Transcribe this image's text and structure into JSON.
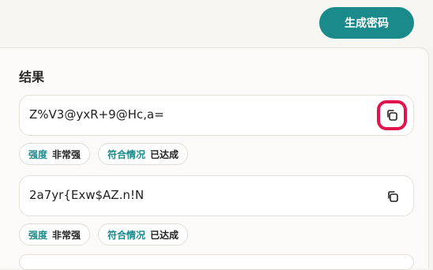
{
  "header": {
    "generate_label": "生成密码"
  },
  "results": {
    "title": "结果",
    "items": [
      {
        "password": "Z%V3@yxR+9@Hc,a=",
        "strength_label": "强度",
        "strength_value": "非常强",
        "compliance_label": "符合情况",
        "compliance_value": "已达成",
        "copy_icon": "copy-icon"
      },
      {
        "password": "2a7yr{Exw$AZ.n!N",
        "strength_label": "强度",
        "strength_value": "非常强",
        "compliance_label": "符合情况",
        "compliance_value": "已达成",
        "copy_icon": "copy-icon"
      }
    ]
  },
  "colors": {
    "accent": "#1a8a8a",
    "highlight": "#e0154f"
  }
}
